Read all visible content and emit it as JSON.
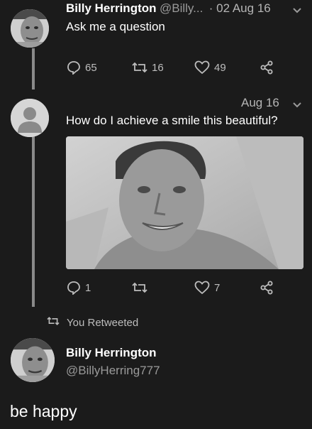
{
  "tweet1": {
    "name": "Billy Herrington",
    "handle": "@Billy...",
    "date": "· 02 Aug 16",
    "text": "Ask me a question",
    "replies": "65",
    "retweets": "16",
    "likes": "49"
  },
  "tweet2": {
    "date": "Aug 16",
    "text": "How do I achieve a smile this beautiful?",
    "replies": "1",
    "retweets": "",
    "likes": "7"
  },
  "retweet_notice": "You Retweeted",
  "tweet3": {
    "name": "Billy Herrington",
    "handle": "@BillyHerring777",
    "text": "be happy"
  },
  "icons": {
    "reply": "reply-icon",
    "retweet": "retweet-icon",
    "like": "heart-icon",
    "share": "share-icon",
    "menu": "chevron-down-icon"
  },
  "colors": {
    "background": "#1b1b1b",
    "secondary_text": "#9a9a9a",
    "thread_line": "#8a8a8a"
  }
}
